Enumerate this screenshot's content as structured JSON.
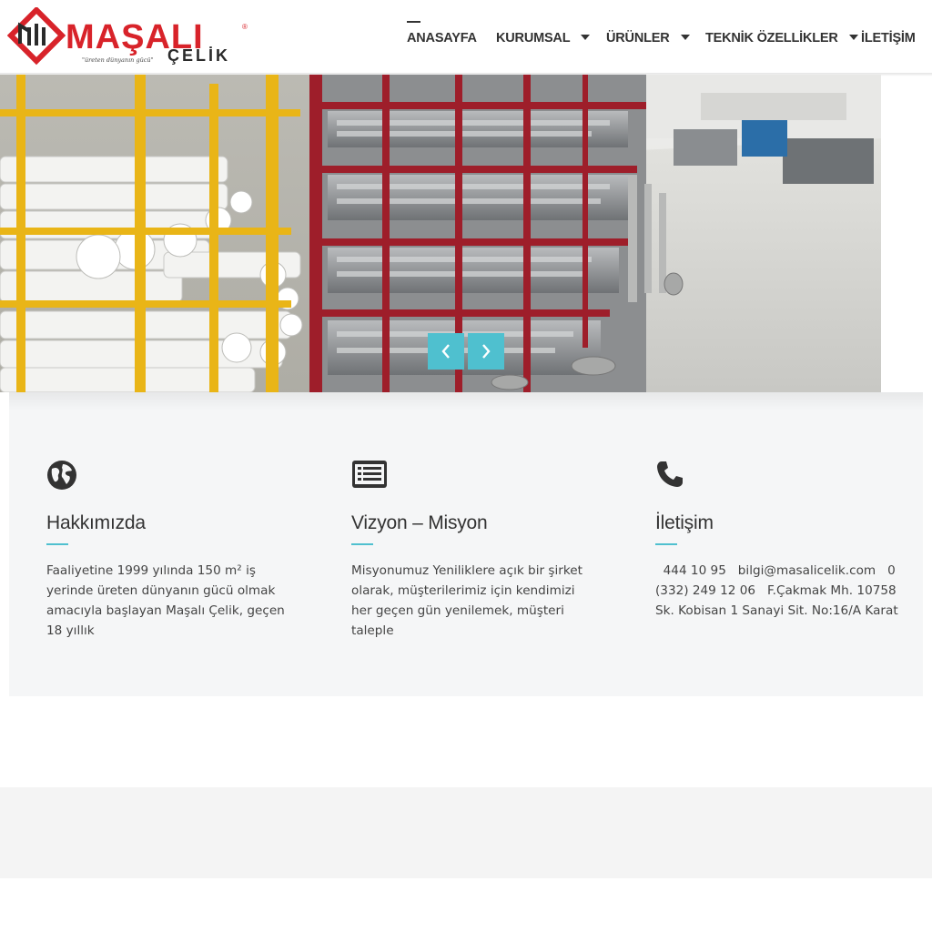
{
  "brand": {
    "name": "MAŞALI",
    "sub": "ÇELİK",
    "tagline": "\"üreten dünyanın gücü\"",
    "registered": "®",
    "red": "#d8232a"
  },
  "nav": {
    "items": [
      {
        "label": "ANASAYFA",
        "active": true,
        "dropdown": false
      },
      {
        "label": "KURUMSAL",
        "active": false,
        "dropdown": true
      },
      {
        "label": "ÜRÜNLER",
        "active": false,
        "dropdown": true
      },
      {
        "label": "TEKNİK ÖZELLİKLER",
        "active": false,
        "dropdown": true
      },
      {
        "label": "İLETİŞİM",
        "active": false,
        "dropdown": false
      }
    ]
  },
  "slider": {
    "prev_icon": "chevron-left-icon",
    "next_icon": "chevron-right-icon",
    "button_color": "#4fc0cf"
  },
  "features": [
    {
      "icon": "globe-icon",
      "title": "Hakkımızda",
      "text": "Faaliyetine 1999 yılında 150 m² iş yerinde üreten dünyanın gücü olmak amacıyla başlayan Maşalı Çelik, geçen 18 yıllık"
    },
    {
      "icon": "list-alt-icon",
      "title": "Vizyon – Misyon",
      "text": "Misyonumuz Yeniliklere açık bir şirket olarak, müşterilerimiz için kendimizi her geçen gün yenilemek, müşteri taleple"
    },
    {
      "icon": "phone-icon",
      "title": "İletişim",
      "text": "  444 10 95   bilgi@masalicelik.com   0 (332) 249 12 06   F.Çakmak Mh. 10758 Sk. Kobisan 1 Sanayi Sit. No:16/A Karat"
    }
  ],
  "colors": {
    "accent": "#4fc0cf",
    "text": "#333333",
    "feature_bg": "#f5f6f7"
  }
}
